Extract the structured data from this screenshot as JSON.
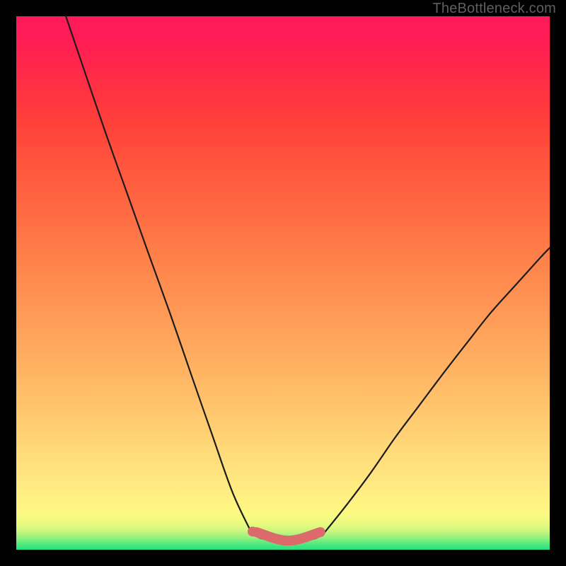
{
  "watermark": "TheBottleneck.com",
  "colors": {
    "curve_stroke": "#1c1c1c",
    "bump_fill": "#dc6a6c",
    "bump_stroke": "#dc6a6c",
    "endpoint_fill": "#dc6a6c"
  },
  "chart_data": {
    "type": "line",
    "title": "",
    "xlabel": "",
    "ylabel": "",
    "xlim": [
      0,
      100
    ],
    "ylim": [
      0,
      100
    ],
    "description": "Bottleneck-style V-curve: steep descending left arm from top-left, flat salmon-colored minimum segment near x≈45–57 at y≈2, then rising right arm that curves and exits right edge around y≈57.",
    "series": [
      {
        "name": "left-arm",
        "x": [
          9.3,
          12.9,
          16.9,
          21.0,
          24.9,
          28.9,
          32.8,
          36.7,
          40.6,
          44.2
        ],
        "y": [
          100.0,
          89.4,
          77.7,
          66.2,
          55.2,
          44.1,
          32.8,
          21.6,
          10.6,
          3.0
        ]
      },
      {
        "name": "flat-min",
        "x": [
          44.2,
          46.0,
          48.0,
          50.0,
          52.0,
          54.0,
          56.0,
          57.6
        ],
        "y": [
          3.0,
          2.1,
          1.9,
          1.9,
          1.9,
          1.9,
          2.1,
          3.0
        ]
      },
      {
        "name": "right-arm",
        "x": [
          57.6,
          62.0,
          66.5,
          71.0,
          75.5,
          80.0,
          84.5,
          89.0,
          93.5,
          98.0,
          100.0
        ],
        "y": [
          3.0,
          8.5,
          14.5,
          21.0,
          27.0,
          33.0,
          38.8,
          44.5,
          49.5,
          54.5,
          56.6
        ]
      }
    ],
    "annotations": {
      "bump_segment_x": [
        45.0,
        57.0
      ],
      "endpoint_x": 44.3
    }
  }
}
